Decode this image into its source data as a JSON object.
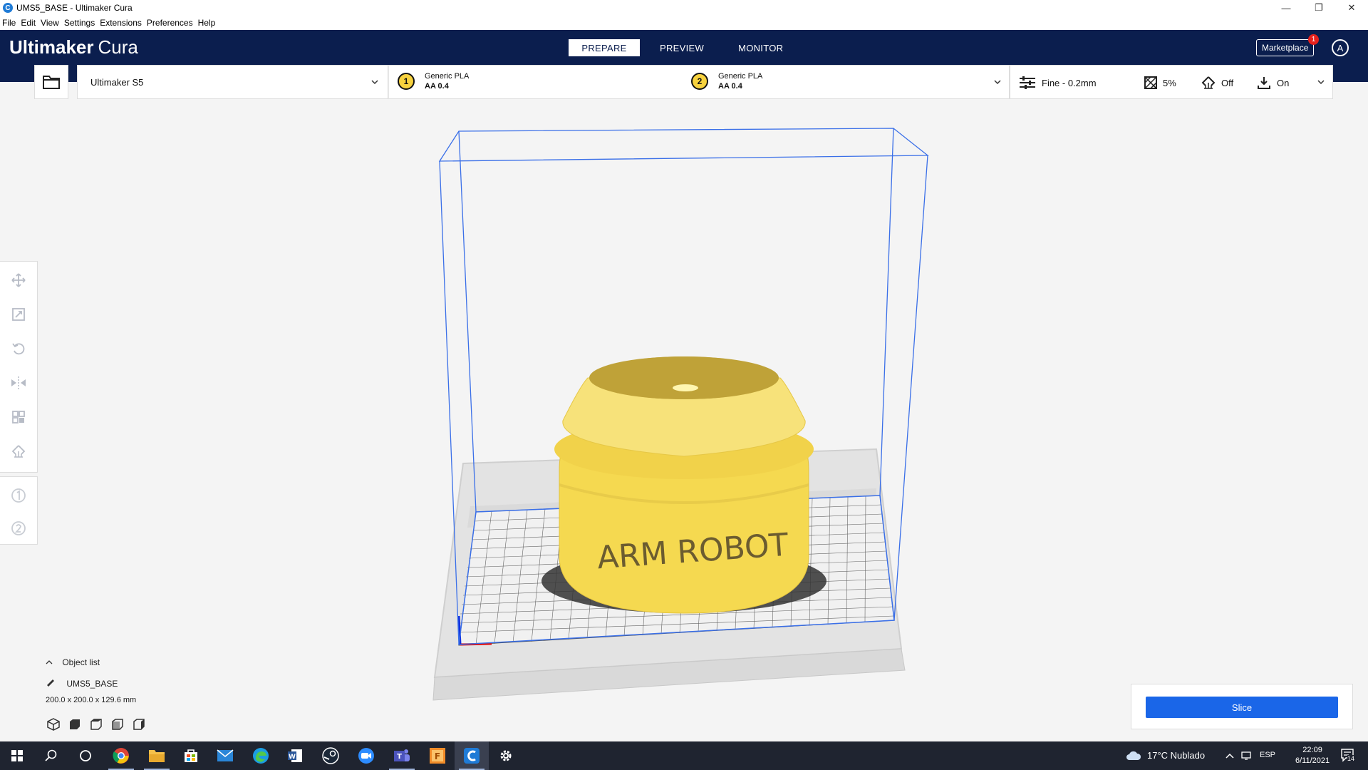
{
  "window": {
    "title": "UMS5_BASE - Ultimaker Cura",
    "minimize": "—",
    "maximize": "❐",
    "close": "✕"
  },
  "menu": [
    "File",
    "Edit",
    "View",
    "Settings",
    "Extensions",
    "Preferences",
    "Help"
  ],
  "header": {
    "brand_bold": "Ultimaker",
    "brand_thin": "Cura",
    "tabs": [
      "PREPARE",
      "PREVIEW",
      "MONITOR"
    ],
    "active_tab": "PREPARE",
    "marketplace": "Marketplace",
    "marketplace_badge": "1",
    "account_initial": "A"
  },
  "printer": {
    "name": "Ultimaker S5"
  },
  "extruders": [
    {
      "number": "1",
      "material": "Generic PLA",
      "core": "AA 0.4"
    },
    {
      "number": "2",
      "material": "Generic PLA",
      "core": "AA 0.4"
    }
  ],
  "print_settings": {
    "profile": "Fine - 0.2mm",
    "infill": "5%",
    "support": "Off",
    "adhesion": "On"
  },
  "object_list": {
    "header": "Object list",
    "object_name": "UMS5_BASE",
    "dimensions": "200.0 x 200.0 x 129.6 mm"
  },
  "model": {
    "label": "ARM ROBOT",
    "color": "#f7e27a"
  },
  "slice": {
    "label": "Slice",
    "color": "#1a66e8"
  },
  "taskbar": {
    "weather": "17°C  Nublado",
    "language": "ESP",
    "time": "22:09",
    "date": "6/11/2021",
    "notifications": "14"
  }
}
